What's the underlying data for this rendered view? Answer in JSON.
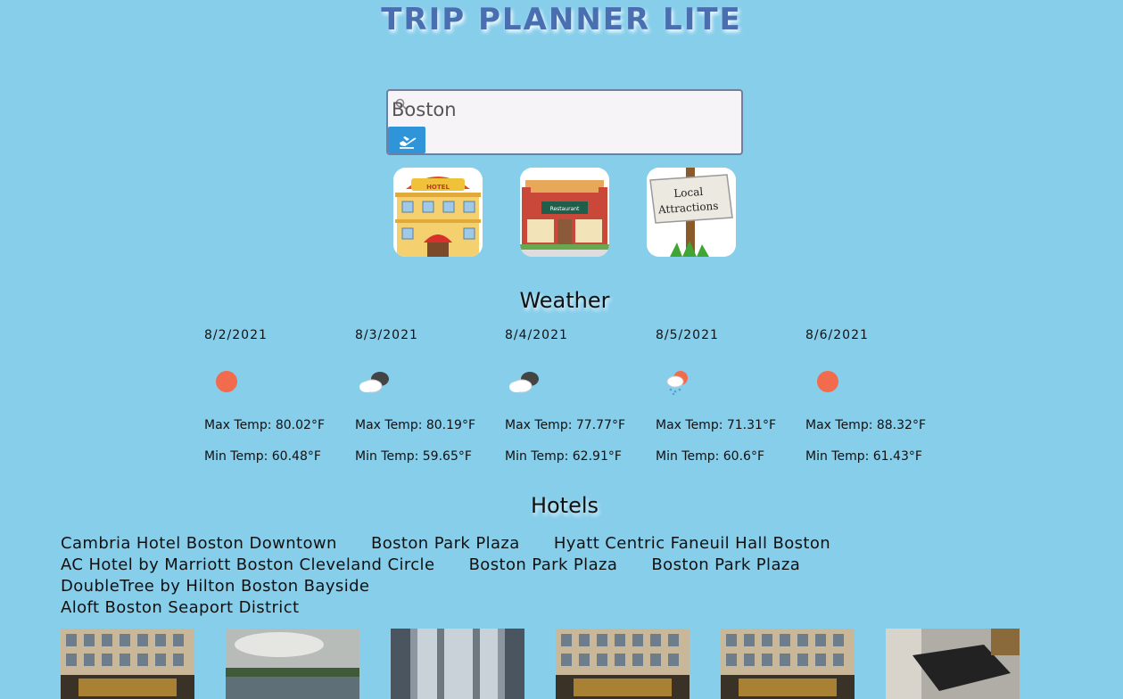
{
  "app": {
    "title": "Trip Planner Lite"
  },
  "search": {
    "value": "Boston",
    "icon": "search-icon",
    "button_icon": "airplane-departure-icon"
  },
  "categories": [
    {
      "name": "hotel",
      "icon": "hotel-building-icon",
      "sign_text": "HOTEL"
    },
    {
      "name": "restaurant",
      "icon": "restaurant-storefront-icon",
      "sign_text": "Restaurant"
    },
    {
      "name": "attractions",
      "icon": "signpost-icon",
      "sign_line1": "Local",
      "sign_line2": "Attractions"
    }
  ],
  "weather": {
    "heading": "Weather",
    "days": [
      {
        "date": "8/2/2021",
        "icon": "sun-icon",
        "max": "Max Temp: 80.02°F",
        "min": "Min Temp: 60.48°F"
      },
      {
        "date": "8/3/2021",
        "icon": "clouds-icon",
        "max": "Max Temp: 80.19°F",
        "min": "Min Temp: 59.65°F"
      },
      {
        "date": "8/4/2021",
        "icon": "clouds-icon",
        "max": "Max Temp: 77.77°F",
        "min": "Min Temp: 62.91°F"
      },
      {
        "date": "8/5/2021",
        "icon": "sun-cloud-rain-icon",
        "max": "Max Temp: 71.31°F",
        "min": "Min Temp: 60.6°F"
      },
      {
        "date": "8/6/2021",
        "icon": "sun-icon",
        "max": "Max Temp: 88.32°F",
        "min": "Min Temp: 61.43°F"
      }
    ]
  },
  "hotels": {
    "heading": "Hotels",
    "items": [
      "Cambria Hotel Boston Downtown",
      "Boston Park Plaza",
      "Hyatt Centric Faneuil Hall Boston",
      "AC Hotel by Marriott Boston Cleveland Circle",
      "Boston Park Plaza",
      "Boston Park Plaza",
      "DoubleTree by Hilton Boston Bayside",
      "Aloft Boston Seaport District"
    ],
    "photos": [
      "hotel-facade-photo",
      "river-view-photo",
      "glass-elevator-photo",
      "hotel-facade-photo",
      "hotel-facade-photo",
      "hotel-room-photo"
    ]
  },
  "colors": {
    "background": "#87ceeb",
    "title": "#4a6fb0",
    "button": "#2f95d8",
    "sun": "#f26b4c"
  }
}
